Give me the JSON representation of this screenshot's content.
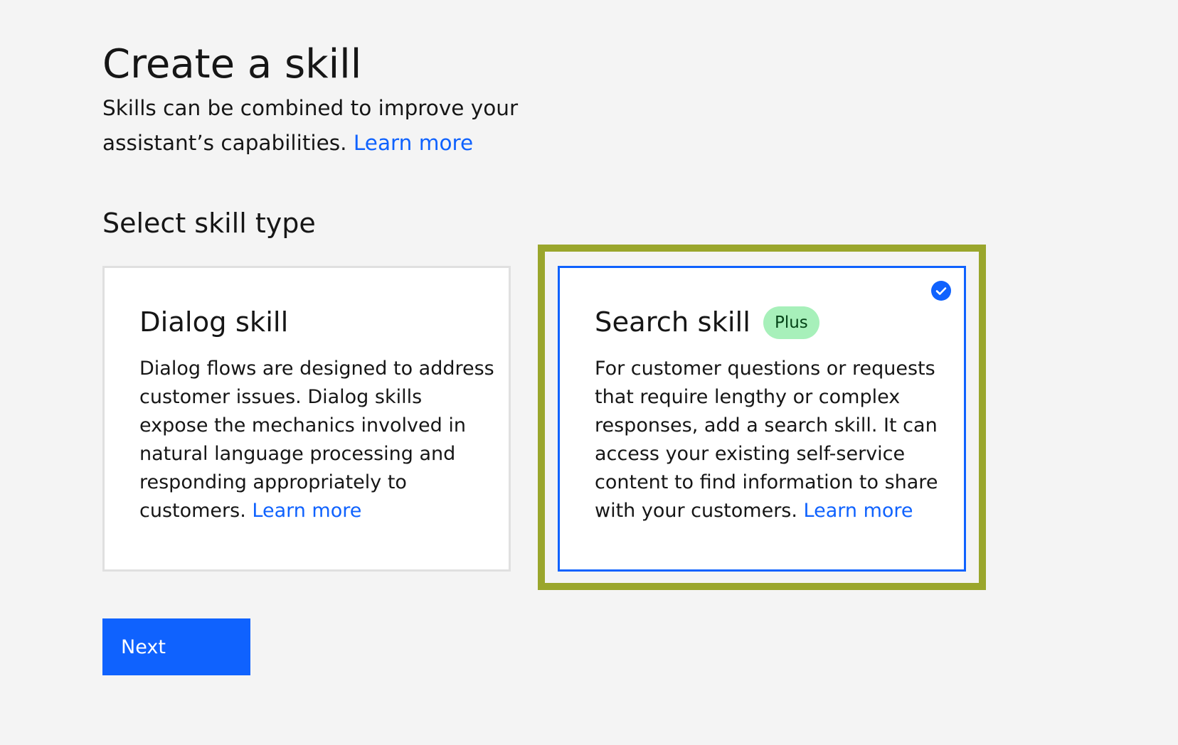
{
  "header": {
    "title": "Create a skill",
    "description": "Skills can be combined to improve your assistant’s capabilities.",
    "learn_more": "Learn more"
  },
  "section": {
    "heading": "Select skill type"
  },
  "cards": [
    {
      "title": "Dialog skill",
      "body": "Dialog flows are designed to address customer issues. Dialog skills expose the mechanics involved in natural language processing and responding appropriately to customers.",
      "learn_more": "Learn more",
      "selected": false
    },
    {
      "title": "Search skill",
      "badge": "Plus",
      "body": "For customer questions or requests that require lengthy or complex responses, add a search skill. It can access your existing self-service content to find information to share with your customers.",
      "learn_more": "Learn more",
      "selected": true,
      "icon": "checkmark-filled-icon"
    }
  ],
  "actions": {
    "next_label": "Next"
  },
  "colors": {
    "background": "#f4f4f4",
    "accent": "#0f62fe",
    "badge_bg": "#a7f0ba",
    "highlight": "#9aa62c",
    "card_border": "#e0e0e0"
  }
}
